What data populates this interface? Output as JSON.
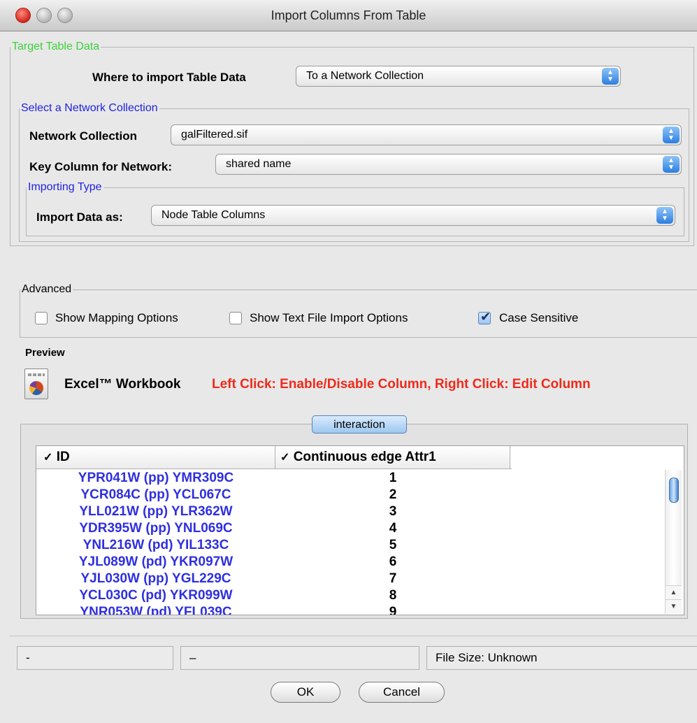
{
  "window": {
    "title": "Import Columns From Table"
  },
  "target": {
    "legend": "Target Table Data",
    "where_label": "Where to import Table Data",
    "where_value": "To a Network Collection",
    "network_section": {
      "legend": "Select a Network Collection",
      "collection_label": "Network Collection",
      "collection_value": "galFiltered.sif",
      "key_label": "Key Column for Network:",
      "key_value": "shared name",
      "importing_type": {
        "legend": "Importing Type",
        "label": "Import Data as:",
        "value": "Node Table Columns"
      }
    }
  },
  "advanced": {
    "legend": "Advanced",
    "options": [
      {
        "label": "Show Mapping Options",
        "checked": false
      },
      {
        "label": "Show Text File Import Options",
        "checked": false
      },
      {
        "label": "Case Sensitive",
        "checked": true
      }
    ]
  },
  "preview": {
    "title": "Preview",
    "source_name": "Excel™ Workbook",
    "hint": "Left Click: Enable/Disable Column, Right Click: Edit Column",
    "sheet_tab": "interaction",
    "columns": [
      "ID",
      "Continuous edge Attr1"
    ],
    "column_check_icon": "✓",
    "rows": [
      {
        "id": "YPR041W (pp) YMR309C",
        "value": "1"
      },
      {
        "id": "YCR084C (pp) YCL067C",
        "value": "2"
      },
      {
        "id": "YLL021W (pp) YLR362W",
        "value": "3"
      },
      {
        "id": "YDR395W (pp) YNL069C",
        "value": "4"
      },
      {
        "id": "YNL216W (pd) YIL133C",
        "value": "5"
      },
      {
        "id": "YJL089W (pd) YKR097W",
        "value": "6"
      },
      {
        "id": "YJL030W (pp) YGL229C",
        "value": "7"
      },
      {
        "id": "YCL030C (pd) YKR099W",
        "value": "8"
      },
      {
        "id": "YNR053W (pd) YFL039C",
        "value": "9"
      }
    ]
  },
  "status_bar": {
    "left": "-",
    "middle": "–",
    "right": "File Size: Unknown"
  },
  "buttons": {
    "ok": "OK",
    "cancel": "Cancel"
  },
  "colors": {
    "legend_green": "#3bd23b",
    "legend_blue": "#2222dd",
    "hint_red": "#ee2a1a",
    "id_blue": "#2f2fe0"
  }
}
